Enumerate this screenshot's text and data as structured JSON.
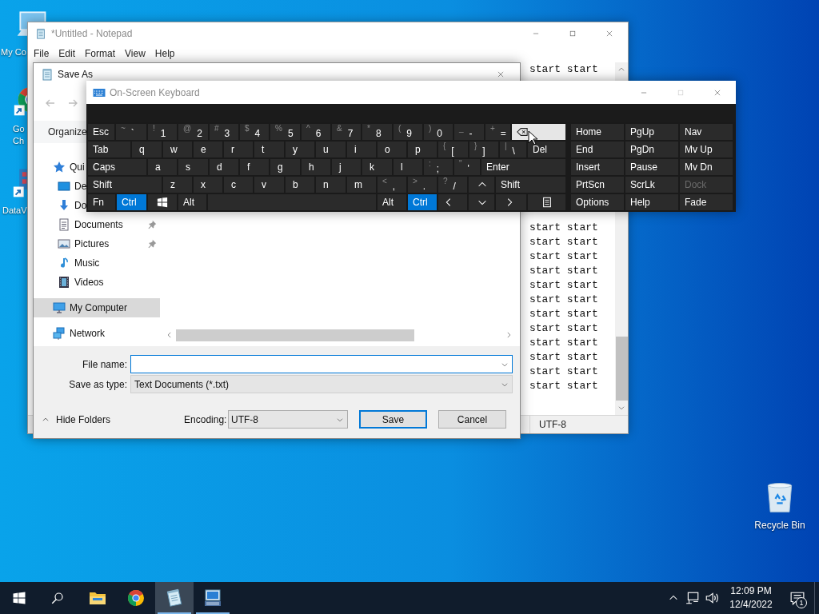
{
  "desktop": {
    "icons": [
      {
        "kind": "computer",
        "label_lines": [
          "My Co"
        ]
      },
      {
        "kind": "chrome",
        "label_lines": [
          "Go",
          "Ch"
        ]
      },
      {
        "kind": "dataview",
        "label_lines": [
          "DataV"
        ]
      },
      {
        "kind": "recycle-bin",
        "label_lines": [
          "Recycle Bin"
        ]
      }
    ]
  },
  "notepad": {
    "title": "*Untitled - Notepad",
    "menu": [
      "File",
      "Edit",
      "Format",
      "View",
      "Help"
    ],
    "lines": [
      "start start",
      "start start",
      "start start",
      "start start",
      "start start",
      "start start",
      "start start",
      "start start",
      "start start",
      "start start",
      "start start",
      "start start",
      "start start"
    ],
    "status_bar": {
      "encoding": "UTF-8"
    }
  },
  "save_as": {
    "title": "Save As",
    "toolbar": {
      "organize": "Organize"
    },
    "nav_pane": [
      {
        "label": "Qui",
        "kind": "quick-access",
        "selected": false,
        "children": [
          {
            "label": "De",
            "kind": "desktop",
            "selected": false
          },
          {
            "label": "Do",
            "kind": "downloads",
            "selected": false
          },
          {
            "label": "Documents",
            "kind": "documents",
            "pinned": true,
            "selected": false
          },
          {
            "label": "Pictures",
            "kind": "pictures",
            "pinned": true,
            "selected": false
          },
          {
            "label": "Music",
            "kind": "music",
            "pinned": false,
            "selected": false
          },
          {
            "label": "Videos",
            "kind": "videos",
            "pinned": false,
            "selected": false
          }
        ]
      },
      {
        "label": "My Computer",
        "kind": "computer",
        "selected": true
      },
      {
        "label": "Network",
        "kind": "network",
        "selected": false
      }
    ],
    "file_name": {
      "label": "File name:"
    },
    "save_as_type": {
      "label": "Save as type:",
      "value": "Text Documents (*.txt)"
    },
    "hide_folders": "Hide Folders",
    "encoding": {
      "label": "Encoding:",
      "value": "UTF-8"
    },
    "buttons": [
      "Save",
      "Cancel"
    ]
  },
  "keyboard": {
    "title": "On-Screen Keyboard",
    "rows": [
      [
        {
          "kind": "text",
          "label": "Esc",
          "active": false,
          "hovered": false
        },
        {
          "kind": "dual",
          "shift": "~",
          "label": "`",
          "active": false,
          "hovered": false
        },
        {
          "kind": "dual",
          "shift": "!",
          "label": "1",
          "active": false,
          "hovered": false
        },
        {
          "kind": "dual",
          "shift": "@",
          "label": "2",
          "active": false,
          "hovered": false
        },
        {
          "kind": "dual",
          "shift": "#",
          "label": "3",
          "active": false,
          "hovered": false
        },
        {
          "kind": "dual",
          "shift": "$",
          "label": "4",
          "active": false,
          "hovered": false
        },
        {
          "kind": "dual",
          "shift": "%",
          "label": "5",
          "active": false,
          "hovered": false
        },
        {
          "kind": "dual",
          "shift": "^",
          "label": "6",
          "active": false,
          "hovered": false
        },
        {
          "kind": "dual",
          "shift": "&",
          "label": "7",
          "active": false,
          "hovered": false
        },
        {
          "kind": "dual",
          "shift": "*",
          "label": "8",
          "active": false,
          "hovered": false
        },
        {
          "kind": "dual",
          "shift": "(",
          "label": "9",
          "active": false,
          "hovered": false
        },
        {
          "kind": "dual",
          "shift": ")",
          "label": "0",
          "active": false,
          "hovered": false
        },
        {
          "kind": "dual",
          "shift": "_",
          "label": "-",
          "active": false,
          "hovered": false
        },
        {
          "kind": "dual",
          "shift": "+",
          "label": "=",
          "active": false,
          "hovered": false
        },
        {
          "kind": "backspace",
          "active": false,
          "hovered": true
        }
      ],
      [
        {
          "kind": "text",
          "label": "Tab",
          "active": false,
          "hovered": false
        },
        {
          "kind": "letter",
          "label": "q",
          "active": false,
          "hovered": false
        },
        {
          "kind": "letter",
          "label": "w",
          "active": false,
          "hovered": false
        },
        {
          "kind": "letter",
          "label": "e",
          "active": false,
          "hovered": false
        },
        {
          "kind": "letter",
          "label": "r",
          "active": false,
          "hovered": false
        },
        {
          "kind": "letter",
          "label": "t",
          "active": false,
          "hovered": false
        },
        {
          "kind": "letter",
          "label": "y",
          "active": false,
          "hovered": false
        },
        {
          "kind": "letter",
          "label": "u",
          "active": false,
          "hovered": false
        },
        {
          "kind": "letter",
          "label": "i",
          "active": false,
          "hovered": false
        },
        {
          "kind": "letter",
          "label": "o",
          "active": false,
          "hovered": false
        },
        {
          "kind": "letter",
          "label": "p",
          "active": false,
          "hovered": false
        },
        {
          "kind": "dual",
          "shift": "{",
          "label": "[",
          "active": false,
          "hovered": false
        },
        {
          "kind": "dual",
          "shift": "}",
          "label": "]",
          "active": false,
          "hovered": false
        },
        {
          "kind": "dual",
          "shift": "|",
          "label": "\\",
          "active": false,
          "hovered": false
        },
        {
          "kind": "text",
          "label": "Del",
          "active": false,
          "hovered": false
        }
      ],
      [
        {
          "kind": "text",
          "label": "Caps",
          "active": false,
          "hovered": false
        },
        {
          "kind": "letter",
          "label": "a",
          "active": false,
          "hovered": false
        },
        {
          "kind": "letter",
          "label": "s",
          "active": false,
          "hovered": false
        },
        {
          "kind": "letter",
          "label": "d",
          "active": false,
          "hovered": false
        },
        {
          "kind": "letter",
          "label": "f",
          "active": false,
          "hovered": false
        },
        {
          "kind": "letter",
          "label": "g",
          "active": false,
          "hovered": false
        },
        {
          "kind": "letter",
          "label": "h",
          "active": false,
          "hovered": false
        },
        {
          "kind": "letter",
          "label": "j",
          "active": false,
          "hovered": false
        },
        {
          "kind": "letter",
          "label": "k",
          "active": false,
          "hovered": false
        },
        {
          "kind": "letter",
          "label": "l",
          "active": false,
          "hovered": false
        },
        {
          "kind": "dual",
          "shift": ":",
          "label": ";",
          "active": false,
          "hovered": false
        },
        {
          "kind": "dual",
          "shift": "\"",
          "label": "'",
          "active": false,
          "hovered": false
        },
        {
          "kind": "text",
          "label": "Enter",
          "active": false,
          "hovered": false
        }
      ],
      [
        {
          "kind": "text",
          "label": "Shift",
          "active": false,
          "hovered": false
        },
        {
          "kind": "letter",
          "label": "z",
          "active": false,
          "hovered": false
        },
        {
          "kind": "letter",
          "label": "x",
          "active": false,
          "hovered": false
        },
        {
          "kind": "letter",
          "label": "c",
          "active": false,
          "hovered": false
        },
        {
          "kind": "letter",
          "label": "v",
          "active": false,
          "hovered": false
        },
        {
          "kind": "letter",
          "label": "b",
          "active": false,
          "hovered": false
        },
        {
          "kind": "letter",
          "label": "n",
          "active": false,
          "hovered": false
        },
        {
          "kind": "letter",
          "label": "m",
          "active": false,
          "hovered": false
        },
        {
          "kind": "dual",
          "shift": "<",
          "label": ",",
          "active": false,
          "hovered": false
        },
        {
          "kind": "dual",
          "shift": ">",
          "label": ".",
          "active": false,
          "hovered": false
        },
        {
          "kind": "dual",
          "shift": "?",
          "label": "/",
          "active": false,
          "hovered": false
        },
        {
          "kind": "arrow-up",
          "active": false,
          "hovered": false
        },
        {
          "kind": "text",
          "label": "Shift",
          "active": false,
          "hovered": false
        }
      ],
      [
        {
          "kind": "text",
          "label": "Fn",
          "active": false,
          "hovered": false
        },
        {
          "kind": "text",
          "label": "Ctrl",
          "active": true,
          "hovered": false
        },
        {
          "kind": "windows",
          "active": false,
          "hovered": false
        },
        {
          "kind": "text",
          "label": "Alt",
          "active": false,
          "hovered": false
        },
        {
          "kind": "space",
          "active": false,
          "hovered": false
        },
        {
          "kind": "text",
          "label": "Alt",
          "active": false,
          "hovered": false
        },
        {
          "kind": "text",
          "label": "Ctrl",
          "active": true,
          "hovered": false
        },
        {
          "kind": "arrow-left",
          "active": false,
          "hovered": false
        },
        {
          "kind": "arrow-down",
          "active": false,
          "hovered": false
        },
        {
          "kind": "arrow-right",
          "active": false,
          "hovered": false
        },
        {
          "kind": "menu",
          "active": false,
          "hovered": false
        }
      ]
    ],
    "side_rows": [
      [
        {
          "kind": "text",
          "label": "Home",
          "disabled": false
        },
        {
          "kind": "text",
          "label": "PgUp",
          "disabled": false
        },
        {
          "kind": "text",
          "label": "Nav",
          "disabled": false
        }
      ],
      [
        {
          "kind": "text",
          "label": "End",
          "disabled": false
        },
        {
          "kind": "text",
          "label": "PgDn",
          "disabled": false
        },
        {
          "kind": "text",
          "label": "Mv Up",
          "disabled": false
        }
      ],
      [
        {
          "kind": "text",
          "label": "Insert",
          "disabled": false
        },
        {
          "kind": "text",
          "label": "Pause",
          "disabled": false
        },
        {
          "kind": "text",
          "label": "Mv Dn",
          "disabled": false
        }
      ],
      [
        {
          "kind": "text",
          "label": "PrtScn",
          "disabled": false
        },
        {
          "kind": "text",
          "label": "ScrLk",
          "disabled": false
        },
        {
          "kind": "text",
          "label": "Dock",
          "disabled": true
        }
      ],
      [
        {
          "kind": "text",
          "label": "Options",
          "disabled": false
        },
        {
          "kind": "text",
          "label": "Help",
          "disabled": false
        },
        {
          "kind": "text",
          "label": "Fade",
          "disabled": false
        }
      ]
    ]
  },
  "taskbar": {
    "apps": [
      {
        "kind": "start",
        "running": false,
        "selected": false
      },
      {
        "kind": "search",
        "running": false,
        "selected": false
      },
      {
        "kind": "explorer",
        "running": false,
        "selected": false
      },
      {
        "kind": "chrome",
        "running": false,
        "selected": false
      },
      {
        "kind": "notepad",
        "running": true,
        "selected": true
      },
      {
        "kind": "keyboard",
        "running": true,
        "selected": false
      }
    ],
    "tray": {
      "time": "12:09 PM",
      "date": "12/4/2022",
      "notifications": "1"
    }
  }
}
